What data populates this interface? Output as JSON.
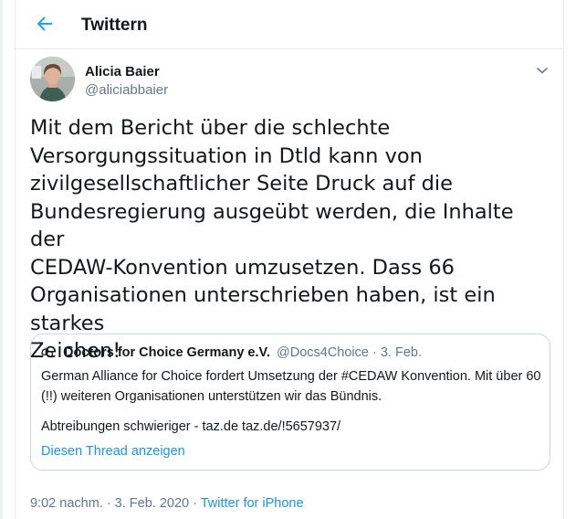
{
  "header": {
    "title": "Twittern"
  },
  "tweet": {
    "author_name": "Alicia Baier",
    "author_handle": "@aliciabbaier",
    "text": "Mit dem Bericht über die schlechte\nVersorgungssituation in Dtld kann von\nzivilgesellschaftlicher Seite Druck auf die\nBundesregierung ausgeübt werden, die Inhalte der\nCEDAW-Konvention umzusetzen. Dass 66\nOrganisationen unterschrieben haben, ist ein starkes\nZeichen!"
  },
  "quote": {
    "name": "Doctors for Choice Germany e.V.",
    "handle_date": "@Docs4Choice · 3. Feb.",
    "text1": "German Alliance for Choice fordert Umsetzung der #CEDAW Konvention. Mit über 60 (!!) weiteren Organisationen unterstützen wir das Bündnis.",
    "text2": "Abtreibungen schwieriger - taz.de taz.de/!5657937/",
    "thread_link": "Diesen Thread anzeigen"
  },
  "meta": {
    "timestamp": "9:02 nachm. · 3. Feb. 2020 · ",
    "source": "Twitter for iPhone"
  },
  "colors": {
    "accent": "#1da1f2",
    "link": "#1b95e0",
    "muted": "#657786",
    "border": "#e6ecf0"
  },
  "icons": {
    "back": "arrow-left-icon",
    "more": "chevron-down-icon",
    "quote_avatar": "organization-logo-icon"
  }
}
